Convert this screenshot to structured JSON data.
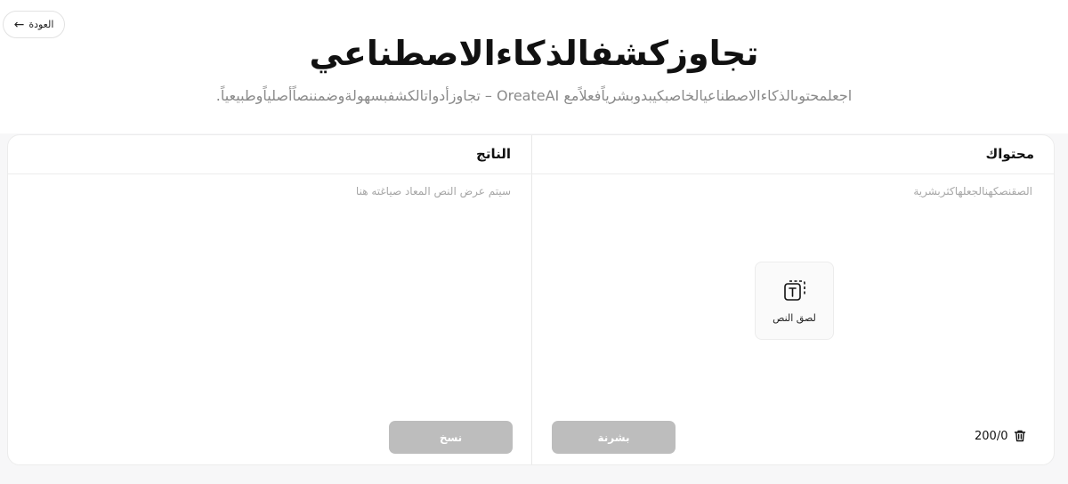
{
  "nav": {
    "back_label": "العودة"
  },
  "hero": {
    "title": "تجاوزكشفالذكاءالاصطناعي",
    "subtitle": "اجعلمحتوىالذكاءالاصطناعيالخاصبكيبدوبشرياًفعلاًمع OreateAI – تجاوزأدواتالكشفبسهولةوضمننصاًأصلياًوطبيعياً."
  },
  "input_panel": {
    "title": "محتواك",
    "placeholder": "الصقنصكهنالجعلهاكثربشرية",
    "paste_label": "لصق النص",
    "humanize_label": "بشرنة",
    "counter": "200/0"
  },
  "output_panel": {
    "title": "الناتج",
    "placeholder": "سيتم عرض النص المعاد صياغته هنا",
    "copy_label": "نسخ"
  },
  "icons": {
    "back": "arrow-left-icon",
    "paste": "paste-text-icon",
    "delete": "trash-icon"
  },
  "colors": {
    "disabled_button": "#bdbdbd",
    "placeholder_text": "#a7a7a7",
    "subtitle_text": "#8a8a8a"
  }
}
